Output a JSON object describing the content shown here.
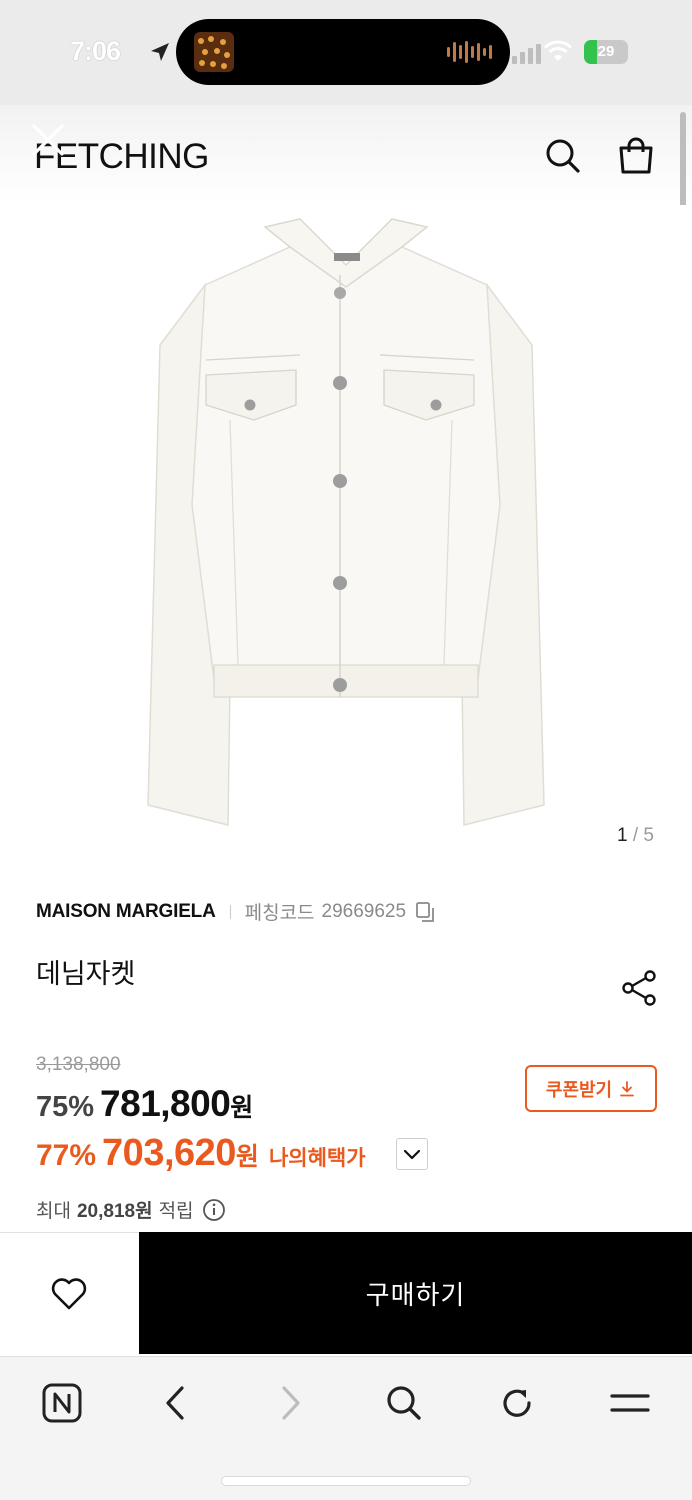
{
  "status_bar": {
    "time": "7:06",
    "battery_text": "29",
    "battery_level": 0.29,
    "battery_color": "#33c24d"
  },
  "header": {
    "logo": "FETCHING",
    "close_icon": "close-icon",
    "search_icon": "search-icon",
    "bag_icon": "shopping-bag-icon"
  },
  "gallery": {
    "current": "1",
    "separator": "/",
    "total": "5"
  },
  "product": {
    "brand": "MAISON MARGIELA",
    "code_label": "페칭코드",
    "code": "29669625",
    "name": "데님자켓"
  },
  "pricing": {
    "original_price": "3,138,800",
    "discount": "75%",
    "price": "781,800",
    "currency": "원",
    "benefit_discount": "77%",
    "benefit_price": "703,620",
    "benefit_label": "나의혜택가",
    "coupon_label": "쿠폰받기",
    "accent_color": "#ea5a1f"
  },
  "points": {
    "prefix": "최대",
    "amount": "20,818원",
    "suffix": "적립"
  },
  "actions": {
    "buy_label": "구매하기",
    "wishlist_icon": "heart-icon"
  },
  "browser_toolbar": {
    "items": [
      "naver-home-icon",
      "back-icon",
      "forward-icon",
      "search-icon",
      "reload-icon",
      "menu-icon"
    ]
  }
}
